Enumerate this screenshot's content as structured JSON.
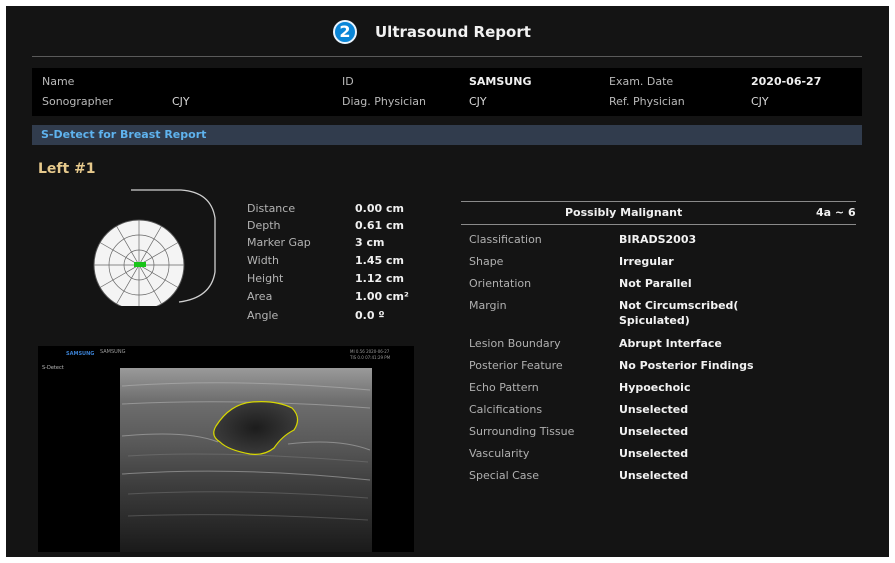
{
  "title": {
    "badge": "2",
    "text": "Ultrasound Report"
  },
  "patient": {
    "name_label": "Name",
    "name_value": "",
    "id_label": "ID",
    "id_value": "SAMSUNG",
    "exam_date_label": "Exam. Date",
    "exam_date_value": "2020-06-27",
    "sonographer_label": "Sonographer",
    "sonographer_value": "CJY",
    "diag_label": "Diag. Physician",
    "diag_value": "CJY",
    "ref_label": "Ref. Physician",
    "ref_value": "CJY"
  },
  "section_title": "S-Detect for Breast Report",
  "lesion_title": "Left #1",
  "measurements": [
    {
      "label": "Distance",
      "value": "0.00 cm"
    },
    {
      "label": "Depth",
      "value": "0.61 cm"
    },
    {
      "label": "Marker Gap",
      "value": "3 cm"
    },
    {
      "label": "Width",
      "value": "1.45 cm"
    },
    {
      "label": "Height",
      "value": "1.12 cm"
    },
    {
      "label": "Area",
      "value": "1.00 cm²"
    },
    {
      "label": "Angle",
      "value": "0.0 º"
    }
  ],
  "image": {
    "brand": "SAMSUNG",
    "brand_small": "SAMSUNG",
    "mode": "S-Detect",
    "info_line1": "MI 0.56  2020-06-27",
    "info_line2": "TIS 0.0  07:41:29 PM"
  },
  "result": {
    "header": "Possibly Malignant",
    "grade": "4a ~ 6",
    "rows": [
      {
        "label": "Classification",
        "value": "BIRADS2003"
      },
      {
        "label": "Shape",
        "value": "Irregular"
      },
      {
        "label": "Orientation",
        "value": "Not Parallel"
      },
      {
        "label": "Margin",
        "value": "Not Circumscribed(",
        "value2": "Spiculated)"
      },
      {
        "label": "Lesion Boundary",
        "value": "Abrupt Interface"
      },
      {
        "label": "Posterior Feature",
        "value": "No Posterior Findings"
      },
      {
        "label": "Echo Pattern",
        "value": "Hypoechoic"
      },
      {
        "label": "Calcifications",
        "value": "Unselected"
      },
      {
        "label": "Surrounding Tissue",
        "value": "Unselected"
      },
      {
        "label": "Vascularity",
        "value": "Unselected"
      },
      {
        "label": "Special Case",
        "value": "Unselected"
      }
    ]
  },
  "colors": {
    "background": "#141414",
    "accent": "#0a86d8",
    "section_header": "#313c4d",
    "lesion_title": "#e6c98c",
    "lesion_outline": "#d8d800",
    "marker": "#19c419"
  },
  "icons": {
    "badge": "number-2-badge-icon",
    "diagram": "breast-clock-diagram-icon"
  }
}
